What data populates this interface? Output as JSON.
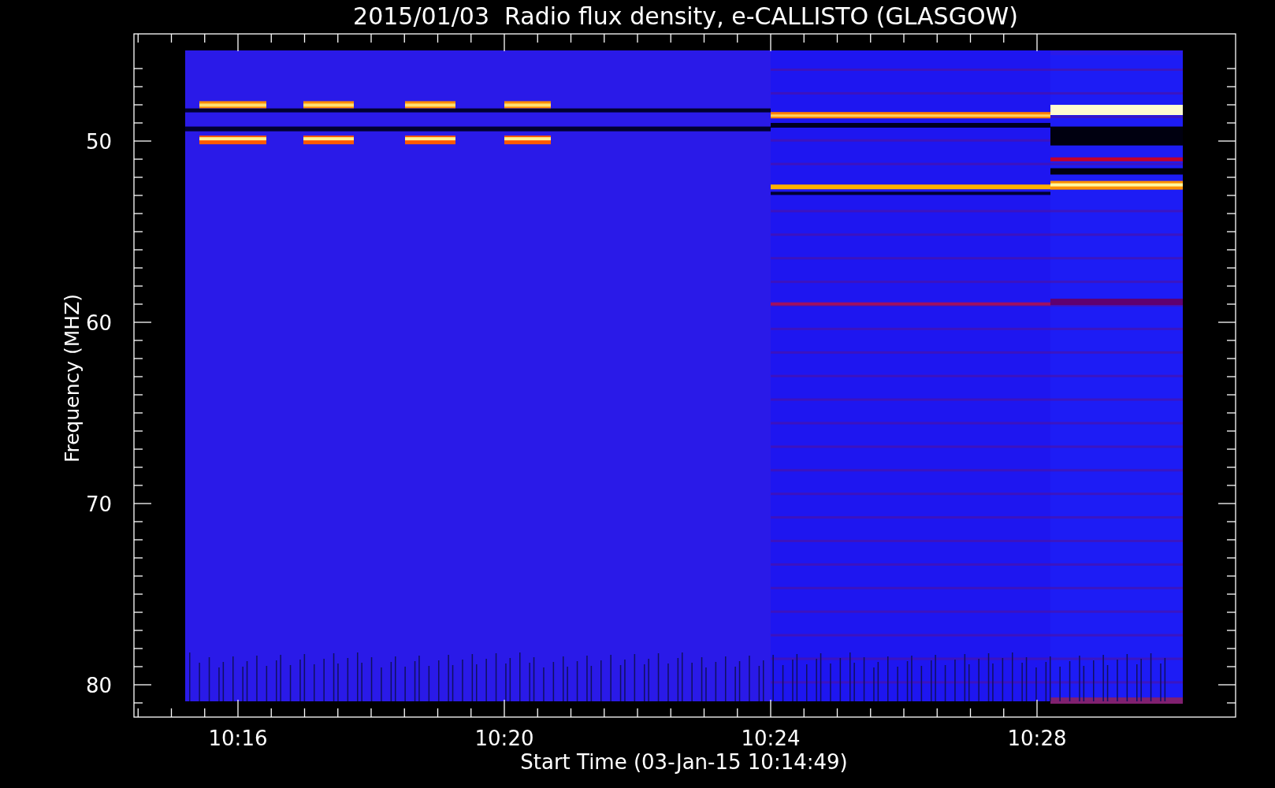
{
  "title": "2015/01/03  Radio flux density, e-CALLISTO (GLASGOW)",
  "plot": {
    "ylabel": "Frequency (MHZ)",
    "xlabel": "Start Time (03-Jan-15 10:14:49)",
    "yticks": [
      "50",
      "60",
      "70",
      "80"
    ],
    "xticks": [
      "10:16",
      "10:20",
      "10:24",
      "10:28"
    ]
  }
}
